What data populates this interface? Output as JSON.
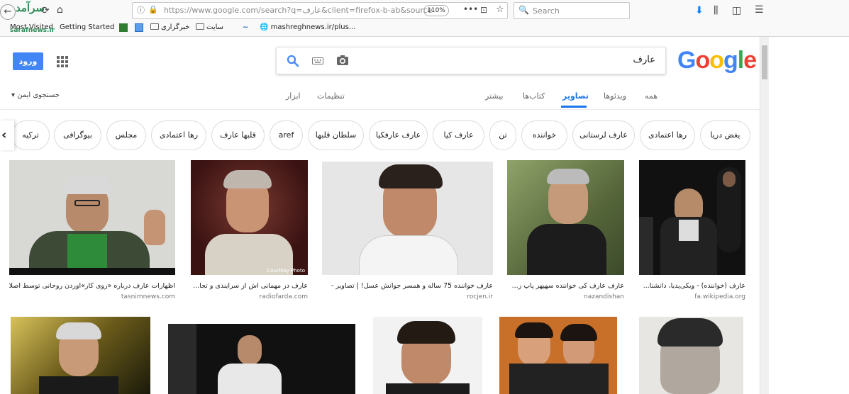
{
  "browser": {
    "url": "https://www.google.com/search?q=عارف&client=firefox-b-ab&source",
    "zoom": "110%",
    "search_placeholder": "Search",
    "bookmarks": [
      "Most Visited",
      "Getting Started",
      "خبرگزاری",
      "سایت",
      "mashreghnews.ir/plus..."
    ],
    "watermark": "سرآمد sarafnews.ir"
  },
  "google": {
    "logo_letters": [
      "G",
      "o",
      "o",
      "g",
      "l",
      "e"
    ],
    "logo_colors": [
      "#4285F4",
      "#EA4335",
      "#FBBC05",
      "#4285F4",
      "#34A853",
      "#EA4335"
    ],
    "query": "عارف",
    "login_label": "ورود",
    "tabs": [
      {
        "label": "همه",
        "active": false
      },
      {
        "label": "ویدئوها",
        "active": false
      },
      {
        "label": "تصاویر",
        "active": true
      },
      {
        "label": "کتاب‌ها",
        "active": false
      },
      {
        "label": "بیشتر",
        "active": false
      }
    ],
    "settings_label": "تنظیمات",
    "tools_label": "ابزار",
    "safesearch_label": "جستجوی ایمن",
    "chips": [
      "یغض دریا",
      "رها اعتمادی",
      "عارف لرستانی",
      "خواننده",
      "تن",
      "عارف کیا",
      "عارف عارفکیا",
      "سلطان قلبها",
      "aref",
      "قلبها عارف",
      "رها اعتمادی",
      "مجلس",
      "بیوگرافی",
      "ترکیه"
    ],
    "results": [
      {
        "caption": "عارف (خواننده) - ویکی‌پدیا، دانشنا...",
        "source": "fa.wikipedia.org"
      },
      {
        "caption": "عارف عارف کی خواننده سهپهر پاپ ز...",
        "source": "nazandishan"
      },
      {
        "caption": "عارف خواننده 75 ساله و همسر جوانش عسل! | تصاویر -",
        "source": "rocjen.ir"
      },
      {
        "caption": "عارف در مهمانی اش از سرایندی و تجا...",
        "source": "radiofarda.com"
      },
      {
        "caption": "اظهارات عارف درباره «روی کار»آوردن روحانی توسط اصلاح...",
        "source": "tasnimnews.com"
      }
    ]
  },
  "colors": {
    "accent": "#1a73e8",
    "login_button": "#4285f4",
    "chip_border": "#dadce0"
  }
}
